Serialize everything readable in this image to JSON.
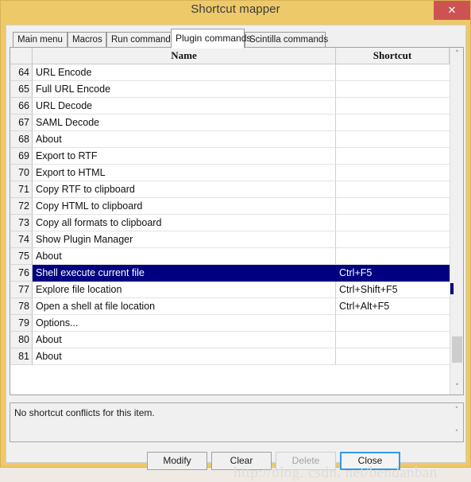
{
  "window": {
    "title": "Shortcut mapper",
    "close_label": "✕",
    "titlebar_color": "#eec96a",
    "close_button_color": "#cd5352",
    "selection_color": "#000080"
  },
  "tabs": [
    {
      "label": "Main menu",
      "selected": false
    },
    {
      "label": "Macros",
      "selected": false
    },
    {
      "label": "Run commands",
      "selected": false
    },
    {
      "label": "Plugin commands",
      "selected": true
    },
    {
      "label": "Scintilla commands",
      "selected": false
    }
  ],
  "table": {
    "columns": [
      "",
      "Name",
      "Shortcut"
    ],
    "rows": [
      {
        "index": "64",
        "name": "URL Encode",
        "shortcut": "",
        "selected": false
      },
      {
        "index": "65",
        "name": "Full URL Encode",
        "shortcut": "",
        "selected": false
      },
      {
        "index": "66",
        "name": "URL Decode",
        "shortcut": "",
        "selected": false
      },
      {
        "index": "67",
        "name": "SAML Decode",
        "shortcut": "",
        "selected": false
      },
      {
        "index": "68",
        "name": "About",
        "shortcut": "",
        "selected": false
      },
      {
        "index": "69",
        "name": "Export to RTF",
        "shortcut": "",
        "selected": false
      },
      {
        "index": "70",
        "name": "Export to HTML",
        "shortcut": "",
        "selected": false
      },
      {
        "index": "71",
        "name": "Copy RTF to clipboard",
        "shortcut": "",
        "selected": false
      },
      {
        "index": "72",
        "name": "Copy HTML to clipboard",
        "shortcut": "",
        "selected": false
      },
      {
        "index": "73",
        "name": "Copy all formats to clipboard",
        "shortcut": "",
        "selected": false
      },
      {
        "index": "74",
        "name": "Show Plugin Manager",
        "shortcut": "",
        "selected": false
      },
      {
        "index": "75",
        "name": "About",
        "shortcut": "",
        "selected": false
      },
      {
        "index": "76",
        "name": "Shell execute current file",
        "shortcut": "Ctrl+F5",
        "selected": true
      },
      {
        "index": "77",
        "name": "Explore file location",
        "shortcut": "Ctrl+Shift+F5",
        "selected": false
      },
      {
        "index": "78",
        "name": "Open a shell at file location",
        "shortcut": "Ctrl+Alt+F5",
        "selected": false
      },
      {
        "index": "79",
        "name": "Options...",
        "shortcut": "",
        "selected": false
      },
      {
        "index": "80",
        "name": "About",
        "shortcut": "",
        "selected": false
      },
      {
        "index": "81",
        "name": "About",
        "shortcut": "",
        "selected": false
      }
    ]
  },
  "scrollbar": {
    "up_arrow": "˄",
    "down_arrow": "˅"
  },
  "status": {
    "message": "No shortcut conflicts for this item.",
    "up_arrow": "˄",
    "down_arrow": "˅"
  },
  "buttons": {
    "modify": "Modify",
    "clear": "Clear",
    "delete": "Delete",
    "close": "Close"
  },
  "watermark": {
    "text": "http://blog. csdn. net/bendanban"
  }
}
